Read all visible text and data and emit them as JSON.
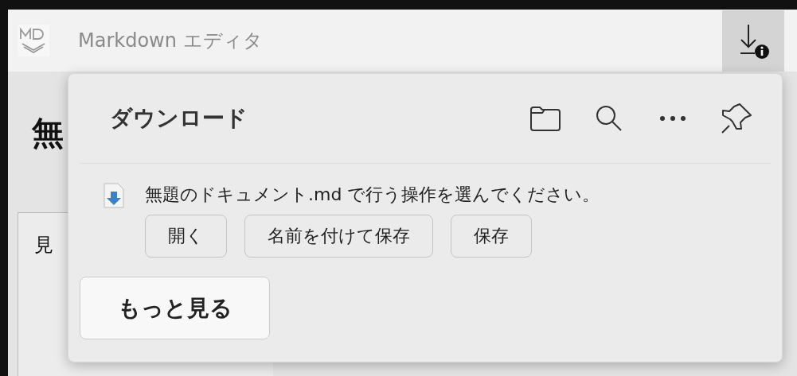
{
  "window": {
    "title": "Markdown エディタ",
    "download_button": {
      "selected": true
    }
  },
  "document": {
    "heading": "無",
    "section_label": "見"
  },
  "downloads_panel": {
    "title": "ダウンロード",
    "item": {
      "message": "無題のドキュメント.md で行う操作を選んでください。",
      "actions": [
        {
          "label": "開く"
        },
        {
          "label": "名前を付けて保存"
        },
        {
          "label": "保存"
        }
      ]
    },
    "more_button": "もっと見る"
  }
}
